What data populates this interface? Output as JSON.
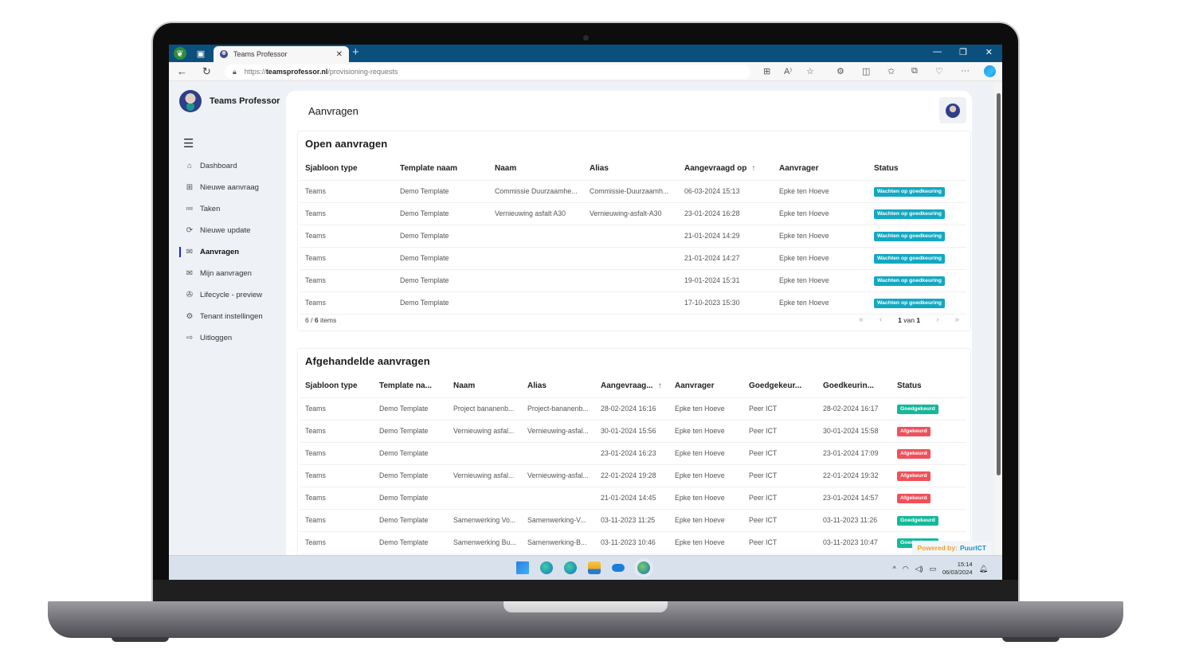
{
  "browser": {
    "tab_title": "Teams Professor",
    "url_prefix": "https://",
    "url_domain": "teamsprofessor.nl",
    "url_path": "/provisioning-requests"
  },
  "app": {
    "brand": "Teams Professor",
    "page_title": "Aanvragen",
    "sidebar": {
      "items": [
        {
          "label": "Dashboard",
          "icon": "home-icon"
        },
        {
          "label": "Nieuwe aanvraag",
          "icon": "clipboard-plus-icon"
        },
        {
          "label": "Taken",
          "icon": "list-icon"
        },
        {
          "label": "Nieuwe update",
          "icon": "refresh-icon"
        },
        {
          "label": "Aanvragen",
          "icon": "envelope-open-icon",
          "active": true
        },
        {
          "label": "Mijn aanvragen",
          "icon": "envelope-open-icon"
        },
        {
          "label": "Lifecycle - preview",
          "icon": "lifecycle-icon"
        },
        {
          "label": "Tenant instellingen",
          "icon": "gear-icon"
        },
        {
          "label": "Uitloggen",
          "icon": "logout-icon"
        }
      ]
    }
  },
  "open_requests": {
    "title": "Open aanvragen",
    "columns": [
      "Sjabloon type",
      "Template naam",
      "Naam",
      "Alias",
      "Aangevraagd op",
      "Aanvrager",
      "Status"
    ],
    "sorted_column": "Aangevraagd op",
    "rows": [
      [
        "Teams",
        "Demo Template",
        "Commissie Duurzaamhe...",
        "Commissie-Duurzaamh...",
        "06-03-2024 15:13",
        "Epke ten Hoeve",
        "Wachten op goedkeuring"
      ],
      [
        "Teams",
        "Demo Template",
        "Vernieuwing asfalt A30",
        "Vernieuwing-asfalt-A30",
        "23-01-2024 16:28",
        "Epke ten Hoeve",
        "Wachten op goedkeuring"
      ],
      [
        "Teams",
        "Demo Template",
        "",
        "",
        "21-01-2024 14:29",
        "Epke ten Hoeve",
        "Wachten op goedkeuring"
      ],
      [
        "Teams",
        "Demo Template",
        "",
        "",
        "21-01-2024 14:27",
        "Epke ten Hoeve",
        "Wachten op goedkeuring"
      ],
      [
        "Teams",
        "Demo Template",
        "",
        "",
        "19-01-2024 15:31",
        "Epke ten Hoeve",
        "Wachten op goedkeuring"
      ],
      [
        "Teams",
        "Demo Template",
        "",
        "",
        "17-10-2023 15:30",
        "Epke ten Hoeve",
        "Wachten op goedkeuring"
      ]
    ],
    "count_shown": "6",
    "count_total": "6",
    "count_suffix": "items",
    "page_current": "1",
    "page_sep": "van",
    "page_total": "1"
  },
  "closed_requests": {
    "title": "Afgehandelde aanvragen",
    "columns": [
      "Sjabloon type",
      "Template na...",
      "Naam",
      "Alias",
      "Aangevraag...",
      "Aanvrager",
      "Goedgekeur...",
      "Goedkeurin...",
      "Status"
    ],
    "sorted_column": "Aangevraag...",
    "rows": [
      [
        "Teams",
        "Demo Template",
        "Project bananenb...",
        "Project-bananenb...",
        "28-02-2024 16:16",
        "Epke ten Hoeve",
        "Peer ICT",
        "28-02-2024 16:17",
        "Goedgekeurd"
      ],
      [
        "Teams",
        "Demo Template",
        "Vernieuwing asfal...",
        "Vernieuwing-asfal...",
        "30-01-2024 15:56",
        "Epke ten Hoeve",
        "Peer ICT",
        "30-01-2024 15:58",
        "Afgekeurd"
      ],
      [
        "Teams",
        "Demo Template",
        "",
        "",
        "23-01-2024 16:23",
        "Epke ten Hoeve",
        "Peer ICT",
        "23-01-2024 17:09",
        "Afgekeurd"
      ],
      [
        "Teams",
        "Demo Template",
        "Vernieuwing asfal...",
        "Vernieuwing-asfal...",
        "22-01-2024 19:28",
        "Epke ten Hoeve",
        "Peer ICT",
        "22-01-2024 19:32",
        "Afgekeurd"
      ],
      [
        "Teams",
        "Demo Template",
        "",
        "",
        "21-01-2024 14:45",
        "Epke ten Hoeve",
        "Peer ICT",
        "23-01-2024 14:57",
        "Afgekeurd"
      ],
      [
        "Teams",
        "Demo Template",
        "Samenwerking Vo...",
        "Samenwerking-V...",
        "03-11-2023 11:25",
        "Epke ten Hoeve",
        "Peer ICT",
        "03-11-2023 11:26",
        "Goedgekeurd"
      ],
      [
        "Teams",
        "Demo Template",
        "Samenwerking Bu...",
        "Samenwerking-B...",
        "03-11-2023 10:46",
        "Epke ten Hoeve",
        "Peer ICT",
        "03-11-2023 10:47",
        "Goedgekeurd"
      ]
    ]
  },
  "status_colors": {
    "Wachten op goedkeuring": "#13a8c2",
    "Goedgekeurd": "#14b89a",
    "Afgekeurd": "#f0505a"
  },
  "powered_by": {
    "label": "Powered by:",
    "brand": "PuurICT"
  },
  "taskbar": {
    "time": "15:14",
    "date": "06/03/2024"
  }
}
